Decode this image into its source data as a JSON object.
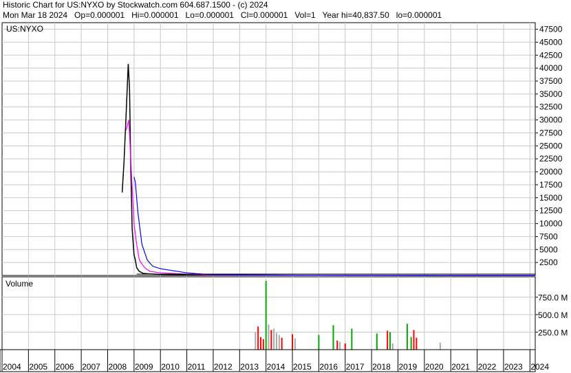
{
  "header": {
    "line1": "Historic Chart for US:NYXO by Stockwatch.com 604.687.1500 - (c) 2024",
    "line2": "Mon Mar 18 2024   Op=0.000001   Hi=0.000001   Lo=0.000001   Cl=0.000001   Vol=1   Year hi=40,837.50   lo=0.000001"
  },
  "chart_data": [
    {
      "type": "line",
      "panel": "price",
      "title": "US:NYXO",
      "y_ticks": [
        "47500",
        "45000",
        "42500",
        "40000",
        "37500",
        "35000",
        "32500",
        "30000",
        "27500",
        "25000",
        "22500",
        "20000",
        "17500",
        "15000",
        "12500",
        "10000",
        "7500",
        "5000",
        "2500"
      ],
      "ylim": [
        0,
        48500
      ],
      "x_ticks": [
        "2004",
        "2005",
        "2006",
        "2007",
        "2008",
        "2009",
        "2010",
        "2011",
        "2012",
        "2013",
        "2014",
        "2015",
        "2016",
        "2017",
        "2018",
        "2019",
        "2020",
        "2021",
        "2022",
        "2023",
        "2024"
      ],
      "grid": true,
      "series": [
        {
          "name": "",
          "color": "#000000",
          "x": [
            2008.55,
            2008.62,
            2008.7,
            2008.78,
            2008.83,
            2008.88,
            2008.93,
            2009.0,
            2009.05,
            2009.1,
            2009.2,
            2009.35,
            2009.6,
            2010,
            2011,
            2012,
            2014,
            2016,
            2018,
            2020,
            2022,
            2024.2
          ],
          "values": [
            16000,
            22000,
            31000,
            40800,
            36000,
            20000,
            9000,
            4000,
            3000,
            1500,
            800,
            400,
            300,
            200,
            150,
            80,
            40,
            20,
            10,
            5,
            2,
            0
          ]
        },
        {
          "name": "",
          "color": "#ff00ff",
          "x": [
            2008.7,
            2008.8,
            2008.9,
            2009.0,
            2009.1,
            2009.2,
            2009.4,
            2009.6,
            2010,
            2011,
            2012,
            2014,
            2016,
            2018,
            2020,
            2022,
            2024.2
          ],
          "values": [
            28000,
            30000,
            20000,
            10000,
            6000,
            3000,
            1500,
            800,
            500,
            250,
            120,
            60,
            30,
            15,
            8,
            3,
            1
          ]
        },
        {
          "name": "",
          "color": "#0000ff",
          "x": [
            2009.0,
            2009.05,
            2009.15,
            2009.3,
            2009.5,
            2009.7,
            2010,
            2010.5,
            2011,
            2011.5,
            2012,
            2014,
            2016,
            2018,
            2020,
            2022,
            2024.2
          ],
          "values": [
            19000,
            18000,
            12000,
            6000,
            3000,
            1800,
            1300,
            900,
            500,
            300,
            150,
            80,
            40,
            20,
            10,
            4,
            1
          ]
        }
      ]
    },
    {
      "type": "bar",
      "panel": "volume",
      "title": "Volume",
      "y_ticks": [
        "750.0 M",
        "500.0 M",
        "250.0 M"
      ],
      "ylim": [
        0,
        1000
      ],
      "units": "M",
      "series": [
        {
          "name": "",
          "color": "#00aa00",
          "x": [
            2014.0,
            2016.0,
            2016.55,
            2017.25,
            2018.2,
            2018.7,
            2019.35,
            2019.5
          ],
          "values": [
            980,
            210,
            350,
            300,
            230,
            250,
            370,
            180
          ]
        },
        {
          "name": "",
          "color": "#ff0000",
          "x": [
            2013.7,
            2013.8,
            2013.9,
            2014.2,
            2014.6,
            2015.0,
            2016.7,
            2017.0,
            2018.6,
            2019.6,
            2019.7
          ],
          "values": [
            330,
            180,
            150,
            280,
            170,
            220,
            130,
            90,
            270,
            280,
            170
          ]
        },
        {
          "name": "",
          "color": "#aaaaaa",
          "x": [
            2013.6,
            2014.1,
            2014.3,
            2014.4,
            2014.5,
            2015.1,
            2016.8,
            2018.8,
            2020.6
          ],
          "values": [
            250,
            360,
            300,
            240,
            210,
            160,
            110,
            90,
            100
          ]
        }
      ]
    }
  ],
  "colors": {
    "grid": "#c8c8c8",
    "price": "#000000",
    "ma_short": "#ff00ff",
    "ma_long": "#0000ff",
    "vol_up": "#00aa00",
    "vol_down": "#ff0000",
    "vol_neutral": "#aaaaaa"
  }
}
